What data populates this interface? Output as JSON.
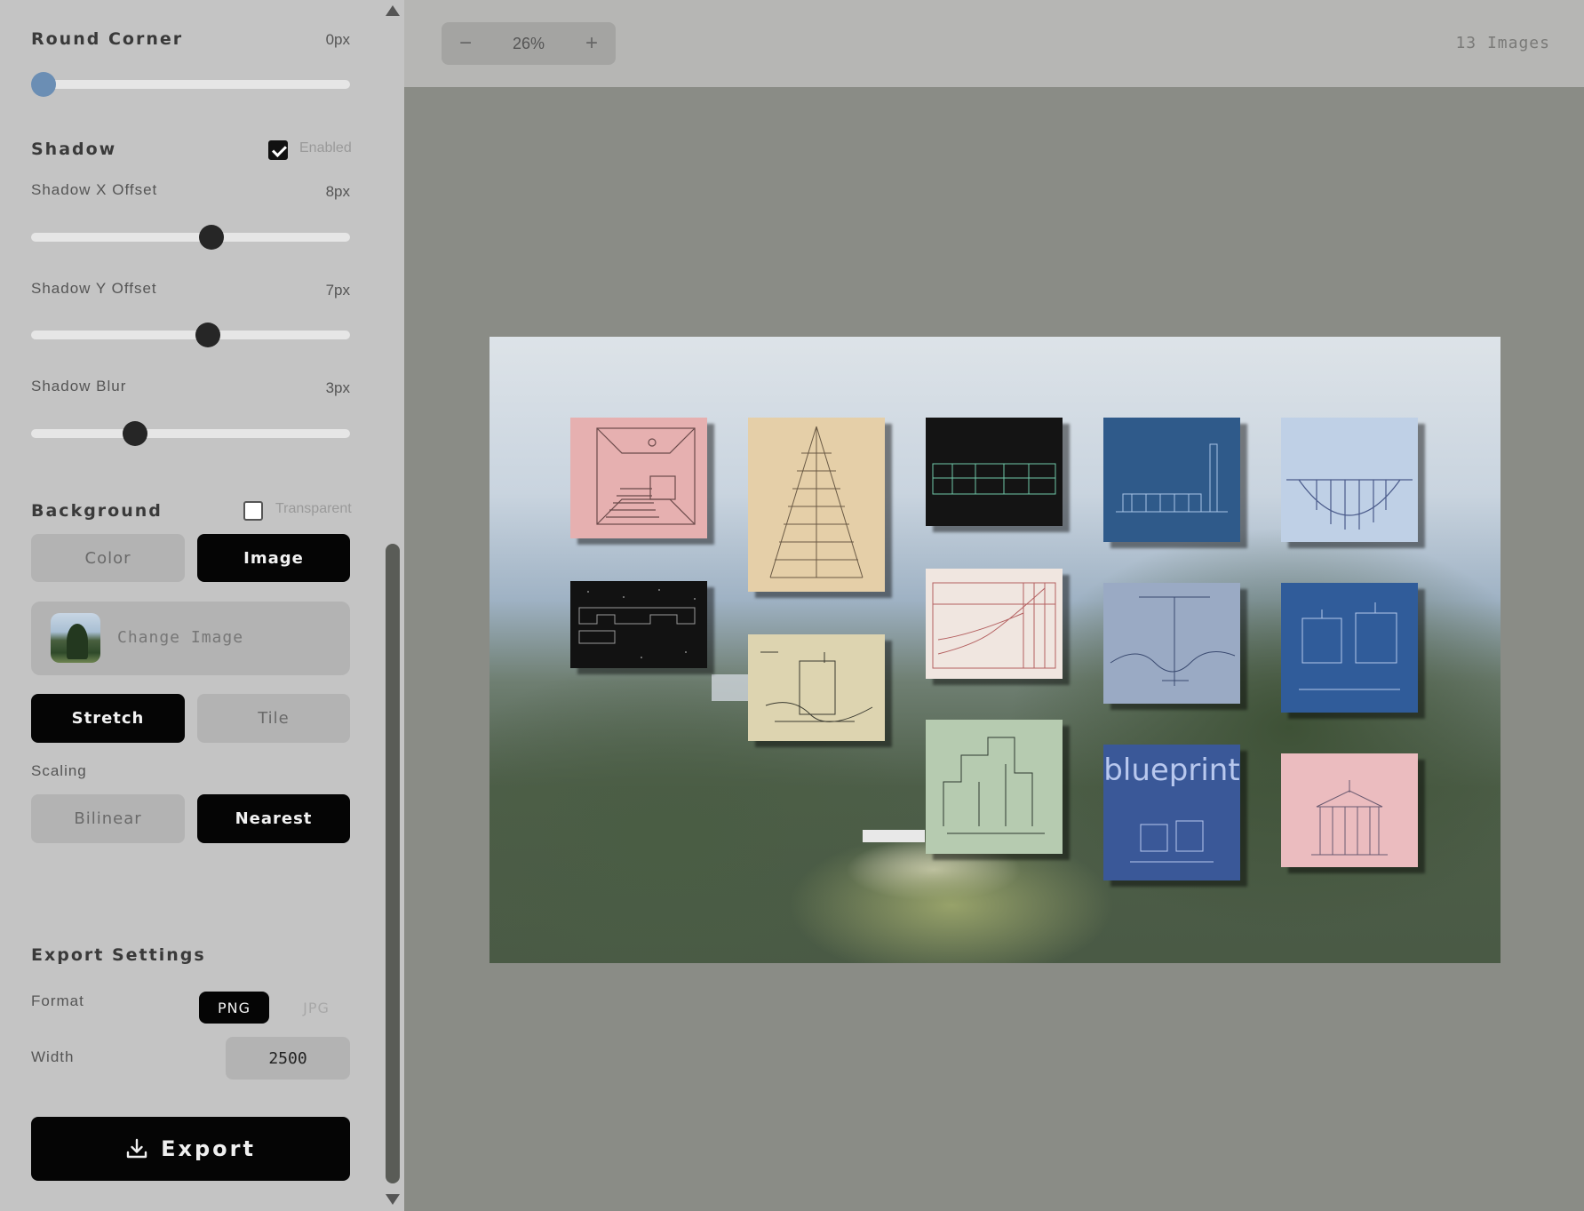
{
  "sidebar": {
    "round_corner": {
      "label": "Round Corner",
      "value": "0px",
      "level": 0.0
    },
    "shadow": {
      "title": "Shadow",
      "enabled_label": "Enabled",
      "enabled": true,
      "x_offset": {
        "label": "Shadow X Offset",
        "value": "8px",
        "level": 0.57
      },
      "y_offset": {
        "label": "Shadow Y Offset",
        "value": "7px",
        "level": 0.56
      },
      "blur": {
        "label": "Shadow Blur",
        "value": "3px",
        "level": 0.31
      }
    },
    "background": {
      "title": "Background",
      "transparent_label": "Transparent",
      "transparent": false,
      "mode_options": [
        "Color",
        "Image"
      ],
      "mode_selected": "Image",
      "change_image_label": "Change Image",
      "fit_options": [
        "Stretch",
        "Tile"
      ],
      "fit_selected": "Stretch",
      "scaling_label": "Scaling",
      "scaling_options": [
        "Bilinear",
        "Nearest"
      ],
      "scaling_selected": "Nearest"
    },
    "export": {
      "title": "Export Settings",
      "format_label": "Format",
      "format_options": [
        "PNG",
        "JPG"
      ],
      "format_selected": "PNG",
      "width_label": "Width",
      "width_value": "2500",
      "button_label": "Export"
    }
  },
  "toolbar": {
    "zoom_out": "−",
    "zoom_value": "26%",
    "zoom_in": "+",
    "image_count": "13 Images"
  },
  "icons": {
    "export": "download-icon",
    "zoom_out": "minus-icon",
    "zoom_in": "plus-icon"
  },
  "canvas": {
    "cards": [
      {
        "name": "pink-staircase-room",
        "bg": "#e6b0b0",
        "ink": "#6a4a4a"
      },
      {
        "name": "tan-tower",
        "bg": "#e5cfa8",
        "ink": "#6a5a45"
      },
      {
        "name": "black-circuit",
        "bg": "#141414",
        "ink": "#6fc7a8"
      },
      {
        "name": "blue-building",
        "bg": "#2f5a8a",
        "ink": "#a9c4e6"
      },
      {
        "name": "lightblue-bridge",
        "bg": "#bfd0e6",
        "ink": "#4a5a8a"
      },
      {
        "name": "black-dots",
        "bg": "#121212",
        "ink": "#9a9a9a"
      },
      {
        "name": "cream-sketch",
        "bg": "#ddd4b0",
        "ink": "#3a3a30"
      },
      {
        "name": "white-chart",
        "bg": "#f0e6e0",
        "ink": "#b46060"
      },
      {
        "name": "slate-tower",
        "bg": "#9aaac4",
        "ink": "#3a4a70"
      },
      {
        "name": "blue-plans",
        "bg": "#305c9a",
        "ink": "#b4c8ea"
      },
      {
        "name": "sage-drawing",
        "bg": "#b6cbb0",
        "ink": "#2f3a30"
      },
      {
        "name": "blueprint-card",
        "bg": "#3a5898",
        "ink": "#b8c8ee",
        "text": "blueprint"
      },
      {
        "name": "pink-temple",
        "bg": "#ebbcbf",
        "ink": "#6a5a70"
      }
    ],
    "blueprint_text": "blueprint"
  }
}
